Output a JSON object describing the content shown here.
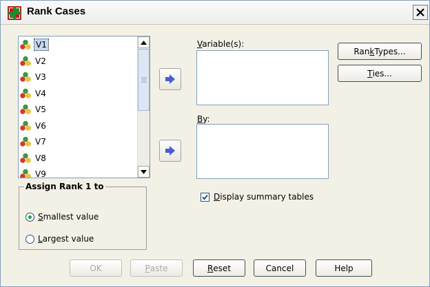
{
  "window": {
    "title": "Rank Cases"
  },
  "variables": [
    {
      "label": "V1",
      "selected": true
    },
    {
      "label": "V2"
    },
    {
      "label": "V3"
    },
    {
      "label": "V4"
    },
    {
      "label": "V5"
    },
    {
      "label": "V6"
    },
    {
      "label": "V7"
    },
    {
      "label": "V8"
    },
    {
      "label": "V9"
    }
  ],
  "variables_box": {
    "label_u": "V",
    "label_rest": "ariable(s):"
  },
  "by_box": {
    "label_u": "B",
    "label_rest": "y:"
  },
  "buttons": {
    "rank_types": {
      "pre": "Ran",
      "u": "k",
      "post": " Types..."
    },
    "ties": {
      "u": "T",
      "post": "ies..."
    },
    "ok": "OK",
    "paste": {
      "u": "P",
      "post": "aste"
    },
    "reset": {
      "u": "R",
      "post": "eset"
    },
    "cancel": "Cancel",
    "help": "Help"
  },
  "assign_rank": {
    "title": "Assign Rank 1 to",
    "options": [
      {
        "u": "S",
        "rest": "mallest value",
        "checked": true
      },
      {
        "u": "L",
        "rest": "argest value",
        "checked": false
      }
    ]
  },
  "display_summary": {
    "u": "D",
    "rest": "isplay summary tables",
    "checked": true
  },
  "icons": {
    "app": "spss-app-icon",
    "close": "close-icon",
    "variable": "scale-variable-icon",
    "move": "move-right-arrow-icon"
  }
}
